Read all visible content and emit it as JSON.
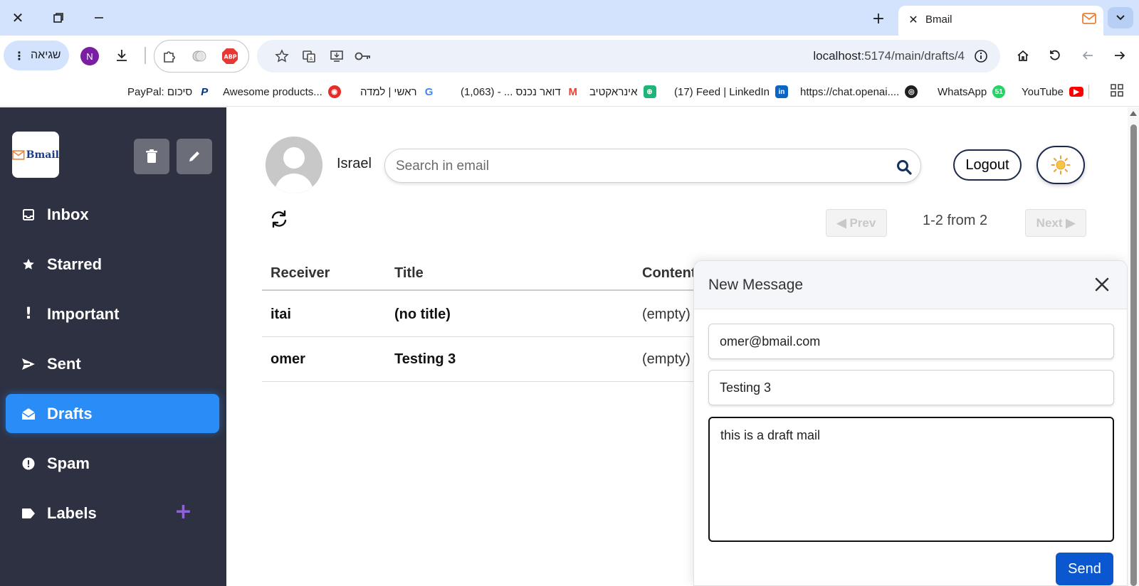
{
  "browser": {
    "tab_title": "Bmail",
    "url_host": "localhost",
    "url_path": ":5174/main/drafts/4",
    "error_chip_label": "שגיאה",
    "profile_initial": "N",
    "abp_label": "ABP",
    "bookmarks": [
      {
        "label": "YouTube",
        "icon": "youtube-icon",
        "color": "#ff0000"
      },
      {
        "label": "WhatsApp",
        "icon": "whatsapp-icon",
        "color": "#25d366"
      },
      {
        "label": "https://chat.openai....",
        "icon": "openai-icon",
        "color": "#1f1f1f"
      },
      {
        "label": "(17) Feed | LinkedIn",
        "icon": "linkedin-icon",
        "color": "#0a66c2"
      },
      {
        "label": "אינראקטיב",
        "icon": "globe-icon",
        "color": "#1fb57a"
      },
      {
        "label": "דואר נכנס ... - (1,063)",
        "icon": "gmail-icon",
        "color": "#ea4335"
      },
      {
        "label": "ראשי | למדה",
        "icon": "google-icon",
        "color": "#4285f4"
      },
      {
        "label": "Awesome products...",
        "icon": "product-icon",
        "color": "#e52d27"
      },
      {
        "label": "PayPal: סיכום",
        "icon": "paypal-icon",
        "color": "#003087"
      }
    ]
  },
  "app": {
    "logo_text": "Bmail",
    "sidebar": {
      "items": [
        {
          "label": "Inbox",
          "icon": "inbox-icon"
        },
        {
          "label": "Starred",
          "icon": "star-icon"
        },
        {
          "label": "Important",
          "icon": "exclamation-icon"
        },
        {
          "label": "Sent",
          "icon": "send-icon"
        },
        {
          "label": "Drafts",
          "icon": "envelope-open-icon",
          "active": true
        },
        {
          "label": "Spam",
          "icon": "spam-icon"
        },
        {
          "label": "Labels",
          "icon": "label-icon"
        }
      ]
    },
    "header": {
      "username": "Israel",
      "search_placeholder": "Search in email",
      "logout_label": "Logout"
    },
    "pagination": {
      "prev_label": "◀ Prev",
      "next_label": "Next ▶",
      "info": "1-2 from 2"
    },
    "table": {
      "headers": [
        "Receiver",
        "Title",
        "Content"
      ],
      "rows": [
        {
          "receiver": "itai",
          "title": "(no title)",
          "content": "(empty)"
        },
        {
          "receiver": "omer",
          "title": "Testing 3",
          "content": "(empty)"
        }
      ]
    },
    "compose": {
      "title": "New Message",
      "to_value": "omer@bmail.com",
      "subject_value": "Testing 3",
      "body_value": "this is a draft mail",
      "send_label": "Send"
    },
    "colors": {
      "sidebar_bg": "#2d3142",
      "active_nav": "#2a8cf7",
      "send_button": "#0b57d0",
      "labels_plus": "#8e63d8"
    }
  }
}
